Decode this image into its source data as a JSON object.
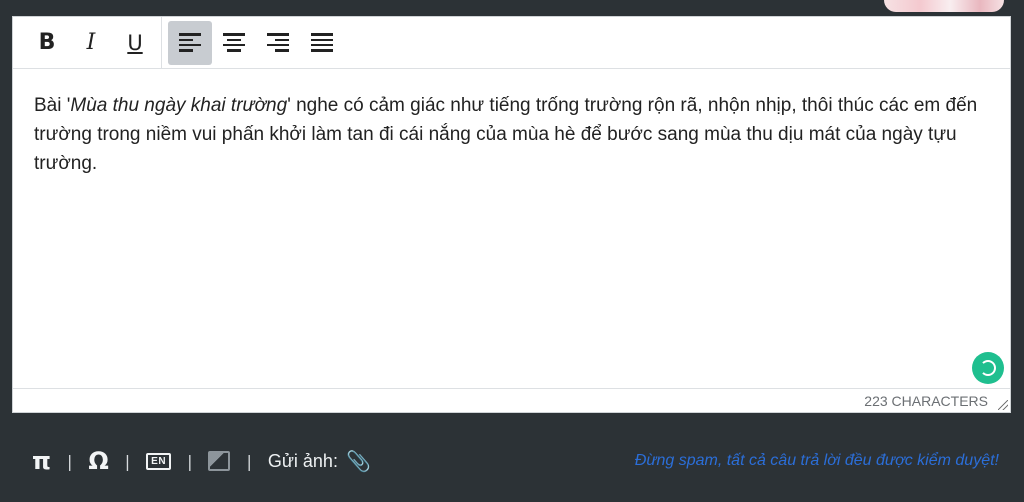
{
  "toolbar": {
    "bold": "B",
    "italic": "I",
    "underline": "U",
    "align_buttons": [
      "align-left-icon",
      "align-center-icon",
      "align-right-icon",
      "align-justify-icon"
    ]
  },
  "content": {
    "prefix": "Bài '",
    "italic_title": "Mùa thu ngày khai trường",
    "suffix": "' nghe có cảm giác như tiếng trống trường rộn rã, nhộn nhịp, thôi thúc các em đến trường trong niềm vui phấn khởi làm tan đi cái nắng của mùa hè để bước sang mùa thu dịu mát của ngày tựu trường."
  },
  "status": {
    "char_count": "223 CHARACTERS"
  },
  "bottom": {
    "pi": "π",
    "omega": "Ω",
    "en_label": "EN",
    "send_image_label": "Gửi ảnh:",
    "notice": "Đừng spam, tất cả câu trả lời đều được kiểm duyệt!"
  },
  "colors": {
    "background": "#2c3236",
    "grammar_check": "#1fbf8f",
    "notice": "#2b6ed8"
  }
}
